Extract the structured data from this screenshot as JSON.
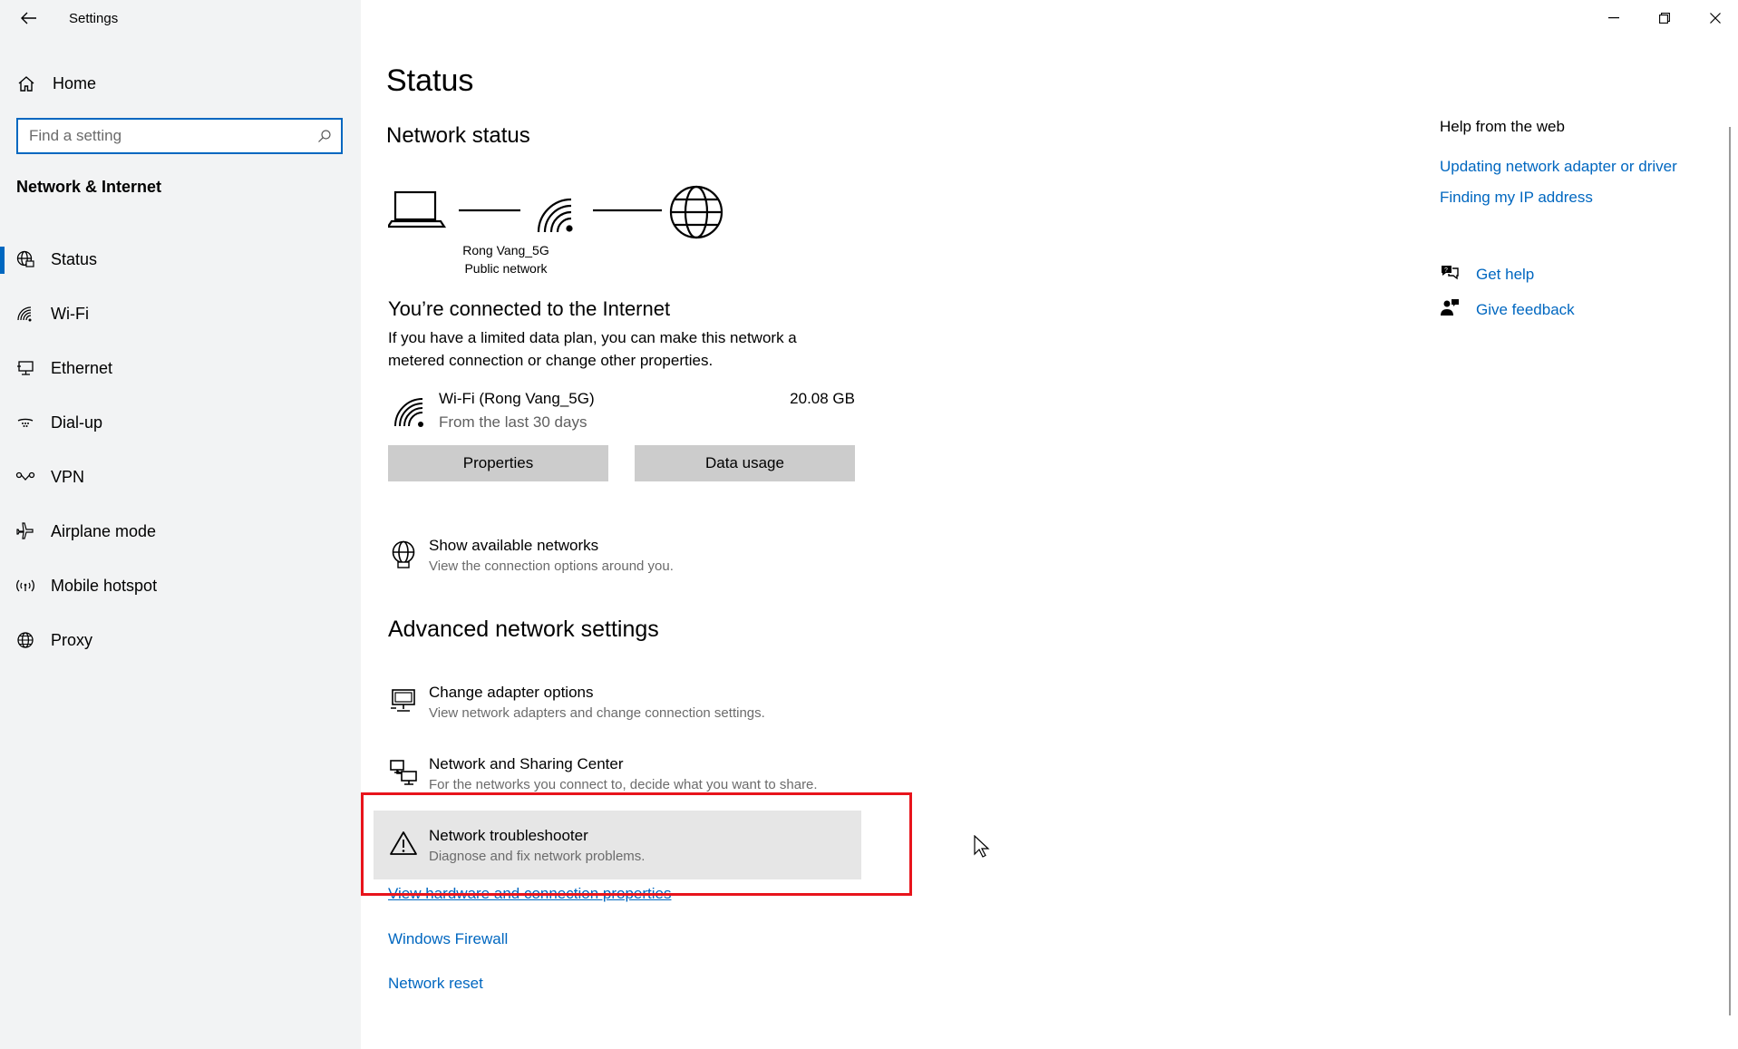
{
  "window": {
    "title": "Settings"
  },
  "sidebar": {
    "home_label": "Home",
    "search_placeholder": "Find a setting",
    "section_title": "Network & Internet",
    "items": [
      {
        "label": "Status",
        "icon": "globe-status-icon",
        "active": true
      },
      {
        "label": "Wi-Fi",
        "icon": "wifi-icon"
      },
      {
        "label": "Ethernet",
        "icon": "ethernet-icon"
      },
      {
        "label": "Dial-up",
        "icon": "dialup-icon"
      },
      {
        "label": "VPN",
        "icon": "vpn-icon"
      },
      {
        "label": "Airplane mode",
        "icon": "airplane-icon"
      },
      {
        "label": "Mobile hotspot",
        "icon": "hotspot-icon"
      },
      {
        "label": "Proxy",
        "icon": "proxy-icon"
      }
    ]
  },
  "main": {
    "title": "Status",
    "network_status_title": "Network status",
    "network_name": "Rong Vang_5G",
    "network_type": "Public network",
    "connected_title": "You’re connected to the Internet",
    "connected_desc": "If you have a limited data plan, you can make this network a metered connection or change other properties.",
    "usage": {
      "name": "Wi-Fi (Rong Vang_5G)",
      "period": "From the last 30 days",
      "amount": "20.08 GB"
    },
    "buttons": {
      "properties": "Properties",
      "data_usage": "Data usage"
    },
    "show_networks": {
      "title": "Show available networks",
      "desc": "View the connection options around you."
    },
    "advanced_title": "Advanced network settings",
    "advanced": {
      "adapter": {
        "title": "Change adapter options",
        "desc": "View network adapters and change connection settings."
      },
      "sharing": {
        "title": "Network and Sharing Center",
        "desc": "For the networks you connect to, decide what you want to share."
      },
      "troubleshooter": {
        "title": "Network troubleshooter",
        "desc": "Diagnose and fix network problems."
      }
    },
    "links": {
      "hardware": "View hardware and connection properties",
      "firewall": "Windows Firewall",
      "reset": "Network reset"
    }
  },
  "help": {
    "title": "Help from the web",
    "links": [
      "Updating network adapter or driver",
      "Finding my IP address"
    ],
    "get_help": "Get help",
    "give_feedback": "Give feedback"
  },
  "colors": {
    "accent": "#0067c0",
    "highlight": "#e8141c",
    "sidebar_bg": "#f2f3f4"
  }
}
